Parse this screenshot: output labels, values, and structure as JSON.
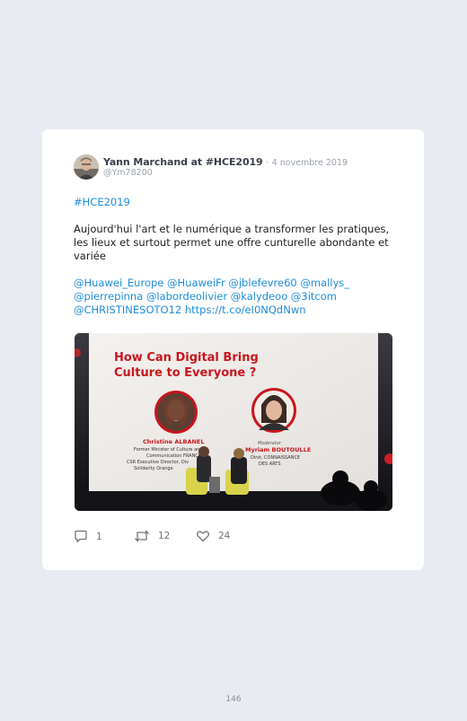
{
  "tweet": {
    "author_name": "Yann Marchand at #HCE2019",
    "separator": "·",
    "date": "4 novembre 2019",
    "handle": "@Ym78200",
    "hashtag_line": "#HCE2019",
    "body": "Aujourd'hui l'art et le numérique a transformer les pratiques, les lieux et surtout permet une offre cunturelle abondante et variée",
    "mentions_line1": "@Huawei_Europe @HuaweiFr @jblefevre60 @mallys_",
    "mentions_line2": "@pierrepinna @labordeolivier @kalydeoo @3itcom",
    "mentions_line3": "@CHRISTINESOTO12 https://t.co/eI0NQdNwn"
  },
  "media": {
    "slide_title_line1": "How Can Digital Bring",
    "slide_title_line2": "Culture to Everyone ?",
    "speaker1_name": "Christine ALBANEL",
    "speaker1_role1": "Former Minister of Culture and",
    "speaker1_role2": "Communication FRANCE",
    "speaker1_role3": "CSR Executive Director, Div",
    "speaker1_role4": "Solidarity Orange",
    "speaker2_label": "Moderator",
    "speaker2_name": "Myriam BOUTOULLE",
    "speaker2_role1": "Dirst, CONNAISSANCE",
    "speaker2_role2": "DES ARTS"
  },
  "actions": {
    "replies": "1",
    "retweets": "12",
    "likes": "24"
  },
  "page": {
    "number": "146"
  },
  "colors": {
    "background": "#e9ebf3",
    "card": "#ffffff",
    "link": "#1d8cd8",
    "slide_red": "#c8161d"
  },
  "icons": {
    "reply": "speech-bubble-icon",
    "retweet": "retweet-icon",
    "like": "heart-icon"
  }
}
